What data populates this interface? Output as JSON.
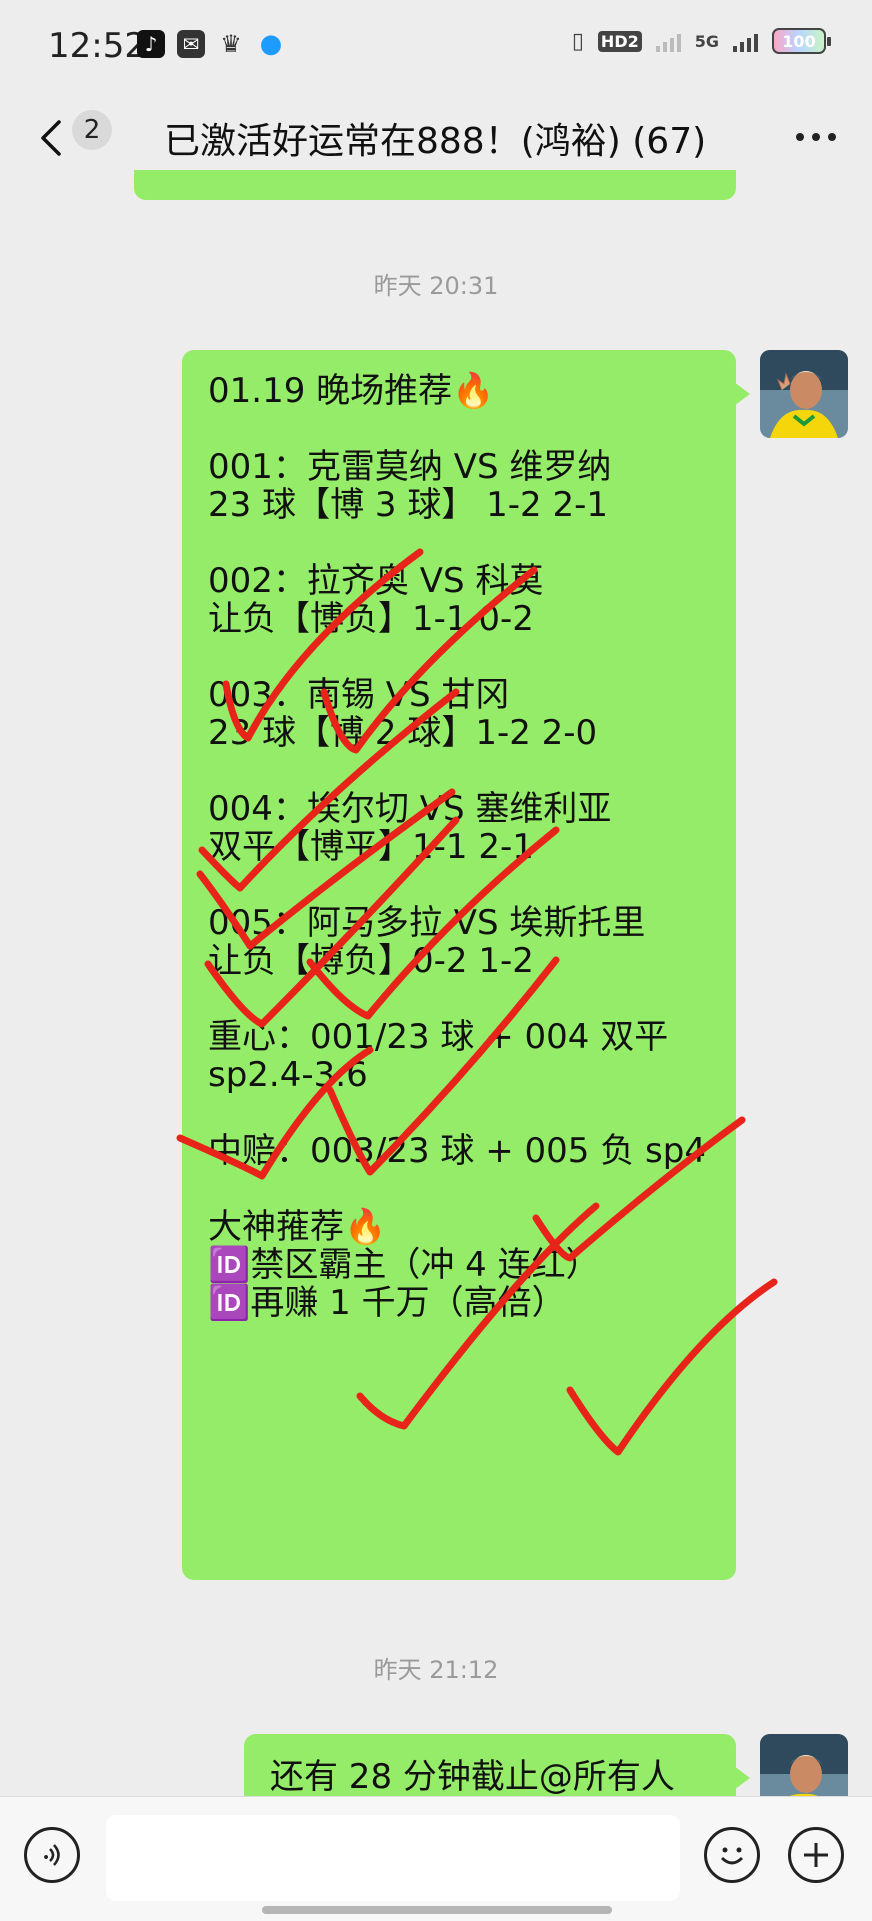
{
  "status_bar": {
    "time": "12:52",
    "hd_label": "HD2",
    "network_label": "5G",
    "battery_level": "100"
  },
  "header": {
    "back_icon": "chevron-left-icon",
    "unread_count": "2",
    "title": "已激活好运常在888！(鸿裕) (67)",
    "more_icon": "more-dots-icon"
  },
  "messages": [
    {
      "timestamp": "昨天 20:31",
      "lines": [
        "01.19 晚场推荐🔥",
        "",
        "001：克雷莫纳 VS 维罗纳",
        "23 球【博 3 球】 1-2 2-1",
        "",
        "002：拉齐奥 VS 科莫",
        "让负【博负】1-1 0-2",
        "",
        "003：南锡 VS 甘冈",
        "23 球【博 2 球】1-2 2-0",
        "",
        "004：埃尔切 VS 塞维利亚",
        "双平【博平】1-1 2-1",
        "",
        "005：阿马多拉 VS 埃斯托里",
        "让负【博负】0-2  1-2",
        "",
        "重心：001/23 球 + 004 双平",
        "sp2.4-3.6",
        "",
        "中赔：003/23 球 + 005 负 sp4",
        "",
        "大神蓷荐🔥",
        "🆔禁区霸主（冲 4 连红）",
        "🆔再赚 1 千万（高倍）"
      ]
    },
    {
      "timestamp": "昨天 21:12",
      "lines": [
        "还有 28 分钟截止@所有人"
      ]
    }
  ],
  "input": {
    "placeholder": "",
    "value": ""
  },
  "colors": {
    "bubble": "#95ec69",
    "background": "#ededed",
    "checkmark": "#e8241a"
  }
}
